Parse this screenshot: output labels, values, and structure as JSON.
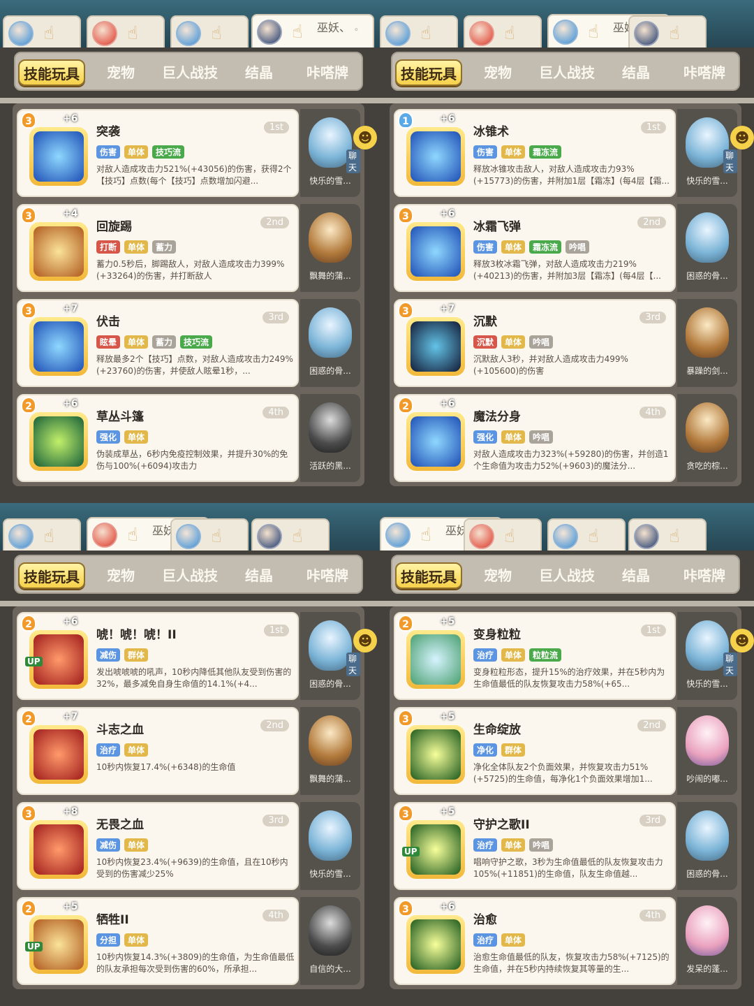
{
  "panels": [
    {
      "player_tabs": [
        {
          "avatar": "blue"
        },
        {
          "avatar": "red"
        },
        {
          "avatar": "blue"
        },
        {
          "avatar": "dark",
          "name": "巫妖、",
          "dots": "。"
        }
      ],
      "menu": [
        "技能玩具",
        "宠物",
        "巨人战技",
        "结晶",
        "咔嗒牌"
      ],
      "skills": [
        {
          "name": "突袭",
          "rank": "1st",
          "level": "3",
          "plus": "+6",
          "icon": "ic-blue",
          "tags": [
            [
              "伤害",
              "blue"
            ],
            [
              "单体",
              "yellow"
            ],
            [
              "技巧流",
              "green"
            ]
          ],
          "desc": "对敌人造成攻击力521%(+43056)的伤害，获得2个【技巧】点数(每个【技巧】点数增加闪避...",
          "pet": "快乐的雪...",
          "pet_style": "",
          "chat": true
        },
        {
          "name": "回旋踢",
          "rank": "2nd",
          "level": "3",
          "plus": "+4",
          "icon": "ic-gold",
          "tags": [
            [
              "打断",
              "red"
            ],
            [
              "单体",
              "yellow"
            ],
            [
              "蓄力",
              "gray"
            ]
          ],
          "desc": "蓄力0.5秒后，脚踢敌人，对敌人造成攻击力399%(+33264)的伤害，并打断敌人",
          "pet": "飘舞的蒲...",
          "pet_style": "brown"
        },
        {
          "name": "伏击",
          "rank": "3rd",
          "level": "3",
          "plus": "+7",
          "icon": "ic-blue",
          "tags": [
            [
              "眩晕",
              "red"
            ],
            [
              "单体",
              "yellow"
            ],
            [
              "蓄力",
              "gray"
            ],
            [
              "技巧流",
              "green"
            ]
          ],
          "desc": "释放最多2个【技巧】点数，对敌人造成攻击力249%(+23760)的伤害，并使敌人眩晕1秒，...",
          "pet": "困惑的骨...",
          "pet_style": ""
        },
        {
          "name": "草丛斗篷",
          "rank": "4th",
          "level": "2",
          "plus": "+6",
          "icon": "ic-green",
          "tags": [
            [
              "强化",
              "blue"
            ],
            [
              "单体",
              "yellow"
            ]
          ],
          "desc": "伪装成草丛，6秒内免疫控制效果，并提升30%的免伤与100%(+6094)攻击力",
          "pet": "活跃的黑...",
          "pet_style": "dark"
        }
      ]
    },
    {
      "player_tabs": [
        {
          "avatar": "blue"
        },
        {
          "avatar": "red"
        },
        {
          "avatar": "blue",
          "name": "巫妖、",
          "dots": "。"
        },
        {
          "avatar": "dark"
        }
      ],
      "menu": [
        "技能玩具",
        "宠物",
        "巨人战技",
        "结晶",
        "咔嗒牌"
      ],
      "skills": [
        {
          "name": "冰锥术",
          "rank": "1st",
          "level": "1",
          "plus": "+6",
          "icon": "ic-blue",
          "tags": [
            [
              "伤害",
              "blue"
            ],
            [
              "单体",
              "yellow"
            ],
            [
              "霜冻流",
              "green"
            ]
          ],
          "desc": "释放冰锥攻击敌人，对敌人造成攻击力93%(+15773)的伤害，并附加1层【霜冻】(每4层【霜...",
          "pet": "快乐的雪...",
          "pet_style": "",
          "chat": true
        },
        {
          "name": "冰霜飞弹",
          "rank": "2nd",
          "level": "3",
          "plus": "+6",
          "icon": "ic-blue",
          "tags": [
            [
              "伤害",
              "blue"
            ],
            [
              "单体",
              "yellow"
            ],
            [
              "霜冻流",
              "green"
            ],
            [
              "吟唱",
              "gray"
            ]
          ],
          "desc": "释放3枚冰霜飞弹，对敌人造成攻击力219%(+40213)的伤害，并附加3层【霜冻】(每4层【...",
          "pet": "困惑的骨...",
          "pet_style": ""
        },
        {
          "name": "沉默",
          "rank": "3rd",
          "level": "3",
          "plus": "+7",
          "icon": "ic-dark",
          "tags": [
            [
              "沉默",
              "red"
            ],
            [
              "单体",
              "yellow"
            ],
            [
              "吟唱",
              "gray"
            ]
          ],
          "desc": "沉默敌人3秒，并对敌人造成攻击力499%(+105600)的伤害",
          "pet": "暴躁的剑...",
          "pet_style": "brown"
        },
        {
          "name": "魔法分身",
          "rank": "4th",
          "level": "2",
          "plus": "+6",
          "icon": "ic-blue",
          "tags": [
            [
              "强化",
              "blue"
            ],
            [
              "单体",
              "yellow"
            ],
            [
              "吟唱",
              "gray"
            ]
          ],
          "desc": "对敌人造成攻击力323%(+59280)的伤害，并创造1个生命值为攻击力52%(+9603)的魔法分...",
          "pet": "贪吃的棕...",
          "pet_style": "brown"
        }
      ]
    },
    {
      "player_tabs": [
        {
          "avatar": "blue"
        },
        {
          "avatar": "red",
          "name": "巫妖、",
          "dots": "。"
        },
        {
          "avatar": "blue"
        },
        {
          "avatar": "dark"
        }
      ],
      "menu": [
        "技能玩具",
        "宠物",
        "巨人战技",
        "结晶",
        "咔嗒牌"
      ],
      "skills": [
        {
          "name": "唬！唬！唬！II",
          "rank": "1st",
          "level": "2",
          "plus": "+6",
          "icon": "ic-red",
          "up": true,
          "tags": [
            [
              "减伤",
              "blue"
            ],
            [
              "群体",
              "yellow"
            ]
          ],
          "desc": "发出唬唬唬的吼声，10秒内降低其他队友受到伤害的32%，最多减免自身生命值的14.1%(+4...",
          "pet": "困惑的骨...",
          "pet_style": "",
          "chat": true
        },
        {
          "name": "斗志之血",
          "rank": "2nd",
          "level": "2",
          "plus": "+7",
          "icon": "ic-red",
          "tags": [
            [
              "治疗",
              "blue"
            ],
            [
              "单体",
              "yellow"
            ]
          ],
          "desc": "10秒内恢复17.4%(+6348)的生命值",
          "pet": "飘舞的蒲...",
          "pet_style": "brown"
        },
        {
          "name": "无畏之血",
          "rank": "3rd",
          "level": "3",
          "plus": "+8",
          "icon": "ic-red",
          "tags": [
            [
              "减伤",
              "blue"
            ],
            [
              "单体",
              "yellow"
            ]
          ],
          "desc": "10秒内恢复23.4%(+9639)的生命值，且在10秒内受到的伤害减少25%",
          "pet": "快乐的雪...",
          "pet_style": ""
        },
        {
          "name": "牺牲II",
          "rank": "4th",
          "level": "2",
          "plus": "+5",
          "icon": "ic-gold",
          "up": true,
          "tags": [
            [
              "分担",
              "blue"
            ],
            [
              "单体",
              "yellow"
            ]
          ],
          "desc": "10秒内恢复14.3%(+3809)的生命值，为生命值最低的队友承担每次受到伤害的60%，所承担...",
          "pet": "自信的大...",
          "pet_style": "dark"
        }
      ]
    },
    {
      "player_tabs": [
        {
          "avatar": "blue",
          "name": "巫妖、",
          "dots": "。"
        },
        {
          "avatar": "red"
        },
        {
          "avatar": "blue"
        },
        {
          "avatar": "dark"
        }
      ],
      "menu": [
        "技能玩具",
        "宠物",
        "巨人战技",
        "结晶",
        "咔嗒牌"
      ],
      "skills": [
        {
          "name": "变身粒粒",
          "rank": "1st",
          "level": "2",
          "plus": "+5",
          "icon": "ic-owl",
          "tags": [
            [
              "治疗",
              "blue"
            ],
            [
              "单体",
              "yellow"
            ],
            [
              "粒粒流",
              "green"
            ]
          ],
          "desc": "变身粒粒形态，提升15%的治疗效果，并在5秒内为生命值最低的队友恢复攻击力58%(+65...",
          "pet": "快乐的雪...",
          "pet_style": "",
          "chat": true
        },
        {
          "name": "生命绽放",
          "rank": "2nd",
          "level": "3",
          "plus": "+5",
          "icon": "ic-heal",
          "tags": [
            [
              "净化",
              "blue"
            ],
            [
              "群体",
              "yellow"
            ]
          ],
          "desc": "净化全体队友2个负面效果，并恢复攻击力51%(+5725)的生命值，每净化1个负面效果增加1...",
          "pet": "吵闹的嘟...",
          "pet_style": "pink"
        },
        {
          "name": "守护之歌II",
          "rank": "3rd",
          "level": "3",
          "plus": "+5",
          "icon": "ic-heal",
          "up": true,
          "tags": [
            [
              "治疗",
              "blue"
            ],
            [
              "单体",
              "yellow"
            ],
            [
              "吟唱",
              "gray"
            ]
          ],
          "desc": "唱响守护之歌，3秒为生命值最低的队友恢复攻击力105%(+11851)的生命值，队友生命值越...",
          "pet": "困惑的骨...",
          "pet_style": ""
        },
        {
          "name": "治愈",
          "rank": "4th",
          "level": "3",
          "plus": "+6",
          "icon": "ic-heal",
          "tags": [
            [
              "治疗",
              "blue"
            ],
            [
              "单体",
              "yellow"
            ]
          ],
          "desc": "治愈生命值最低的队友，恢复攻击力58%(+7125)的生命值，并在5秒内持续恢复其等量的生...",
          "pet": "发呆的蓬...",
          "pet_style": "pink"
        }
      ]
    }
  ],
  "chat_label": "聊天",
  "chat_icon": "☻",
  "hand_icon": "☝"
}
